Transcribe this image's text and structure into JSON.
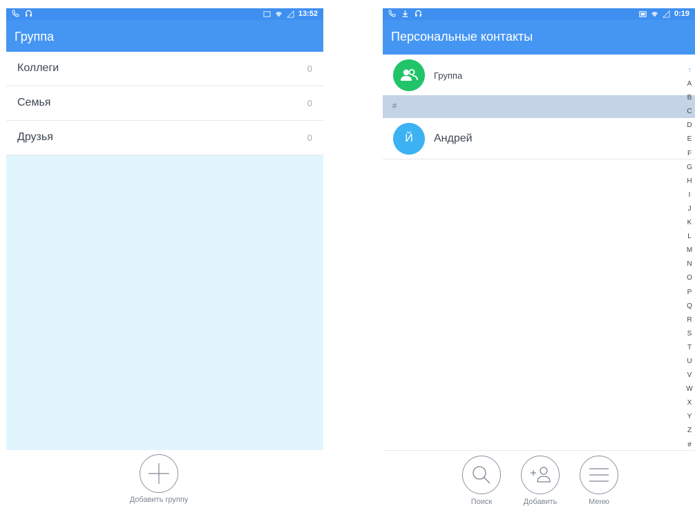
{
  "left_screen": {
    "status_bar": {
      "time": "13:52",
      "left_icons": [
        "phone-call-icon",
        "headset-icon"
      ],
      "right_icons": [
        "screenshot-icon",
        "wifi-icon",
        "signal-icon"
      ]
    },
    "app_bar": {
      "title": "Группа"
    },
    "groups": [
      {
        "name": "Коллеги",
        "count": "0"
      },
      {
        "name": "Семья",
        "count": "0"
      },
      {
        "name": "Друзья",
        "count": "0"
      }
    ],
    "add_group": {
      "icon": "plus-icon",
      "label": "Добавить группу"
    }
  },
  "right_screen": {
    "status_bar": {
      "time": "0:19",
      "left_icons": [
        "phone-call-icon",
        "download-icon",
        "headset-icon"
      ],
      "right_icons": [
        "screenshot-icon",
        "wifi-icon",
        "signal-icon"
      ]
    },
    "app_bar": {
      "title": "Персональные контакты"
    },
    "group_entry": {
      "icon": "people-icon",
      "name": "Группа"
    },
    "section_header": "#",
    "contacts": [
      {
        "initial": "Й",
        "name": "Андрей"
      }
    ],
    "alphabet_index": [
      "↑",
      "A",
      "B",
      "C",
      "D",
      "E",
      "F",
      "G",
      "H",
      "I",
      "J",
      "K",
      "L",
      "M",
      "N",
      "O",
      "P",
      "Q",
      "R",
      "S",
      "T",
      "U",
      "V",
      "W",
      "X",
      "Y",
      "Z",
      "#"
    ],
    "bottom_actions": [
      {
        "icon": "search-icon",
        "label": "Поиск"
      },
      {
        "icon": "add-user-icon",
        "label": "Добавить"
      },
      {
        "icon": "menu-icon",
        "label": "Меню"
      }
    ]
  },
  "colors": {
    "app_bar": "#4596f3",
    "status_bar": "#3f8ff0",
    "empty_area": "#e1f5fe",
    "section_header": "#c4d3e5",
    "avatar_group": "#22c46a",
    "avatar_contact": "#3cb2f3"
  }
}
